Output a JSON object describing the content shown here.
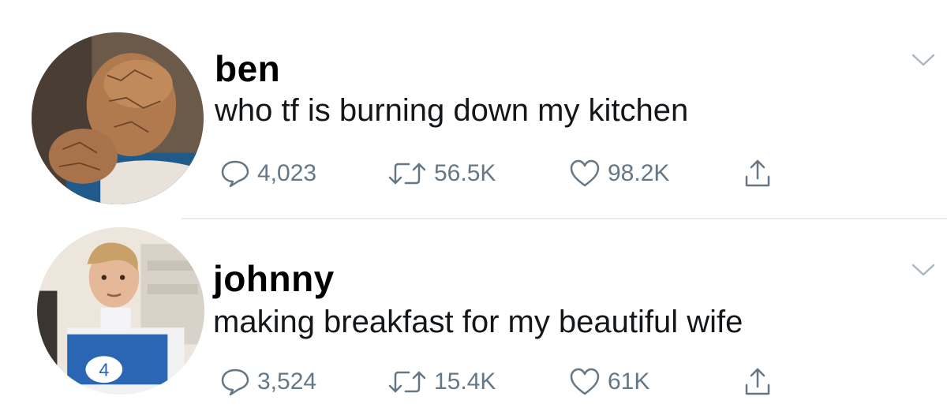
{
  "tweets": [
    {
      "username": "ben",
      "text": "who tf is burning down my kitchen",
      "replies": "4,023",
      "retweets": "56.5K",
      "likes": "98.2K"
    },
    {
      "username": "johnny",
      "text": "making breakfast for my beautiful wife",
      "replies": "3,524",
      "retweets": "15.4K",
      "likes": "61K"
    }
  ],
  "icons": {
    "reply": "speech-bubble-icon",
    "retweet": "retweet-arrows-icon",
    "like": "heart-outline-icon",
    "share": "share-upload-icon",
    "menu": "chevron-down-icon"
  },
  "colors": {
    "text": "#14171a",
    "meta": "#657786",
    "divider": "#e6ecf0"
  }
}
